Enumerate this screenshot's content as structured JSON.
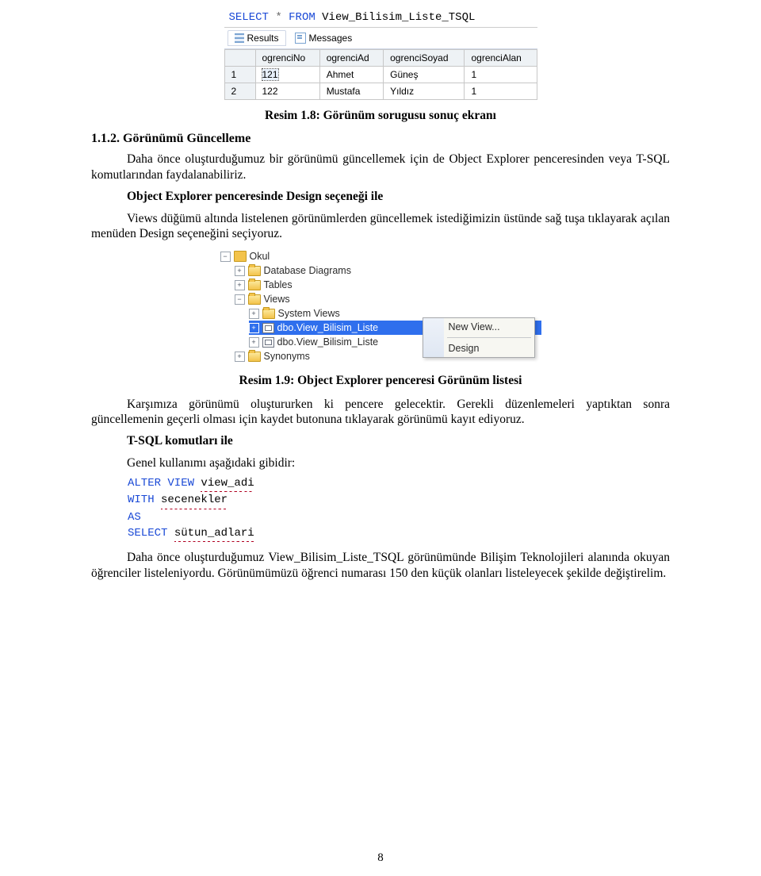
{
  "shot1": {
    "sql_select": "SELECT",
    "sql_star": "*",
    "sql_from": "FROM",
    "sql_view": "View_Bilisim_Liste_TSQL",
    "tab_results": "Results",
    "tab_messages": "Messages",
    "cols": [
      "ogrenciNo",
      "ogrenciAd",
      "ogrenciSoyad",
      "ogrenciAlan"
    ],
    "rows": [
      {
        "n": "1",
        "ogrenciNo": "121",
        "ogrenciAd": "Ahmet",
        "ogrenciSoyad": "Güneş",
        "ogrenciAlan": "1"
      },
      {
        "n": "2",
        "ogrenciNo": "122",
        "ogrenciAd": "Mustafa",
        "ogrenciSoyad": "Yıldız",
        "ogrenciAlan": "1"
      }
    ]
  },
  "caption1": "Resim 1.8: Görünüm sorugusu sonuç ekranı",
  "sec_num": "1.1.2. Görünümü Güncelleme",
  "p1": "Daha önce oluşturduğumuz bir görünümü güncellemek için de Object Explorer penceresinden veya T-SQL komutlarından faydalanabiliriz.",
  "sub1": "Object Explorer penceresinde Design seçeneği ile",
  "p2": "Views düğümü altında listelenen görünümlerden güncellemek istediğimizin üstünde sağ tuşa tıklayarak açılan menüden Design seçeneğini seçiyoruz.",
  "tree": {
    "root": "Okul",
    "n_diagrams": "Database Diagrams",
    "n_tables": "Tables",
    "n_views": "Views",
    "n_sysviews": "System Views",
    "n_view1": "dbo.View_Bilisim_Liste",
    "n_view2": "dbo.View_Bilisim_Liste",
    "n_syn": "Synonyms",
    "menu_new": "New View...",
    "menu_design": "Design"
  },
  "caption2": "Resim 1.9: Object Explorer penceresi Görünüm listesi",
  "p3": "Karşımıza görünümü oluştururken ki pencere gelecektir. Gerekli düzenlemeleri yaptıktan sonra güncellemenin geçerli olması için kaydet butonuna tıklayarak görünümü kayıt ediyoruz.",
  "sub2": "T-SQL komutları ile",
  "p4": "Genel kullanımı aşağıdaki gibidir:",
  "code2": {
    "k_alter": "ALTER VIEW",
    "v_name": "view_adi",
    "k_with": "WITH",
    "v_opts": "secenekler",
    "k_as": "AS",
    "k_select": "SELECT",
    "v_cols": "sütun_adlari"
  },
  "p5": "Daha önce oluşturduğumuz View_Bilisim_Liste_TSQL görünümünde Bilişim Teknolojileri alanında okuyan öğrenciler listeleniyordu. Görünümümüzü öğrenci numarası 150 den küçük olanları listeleyecek şekilde değiştirelim.",
  "pagenum": "8"
}
